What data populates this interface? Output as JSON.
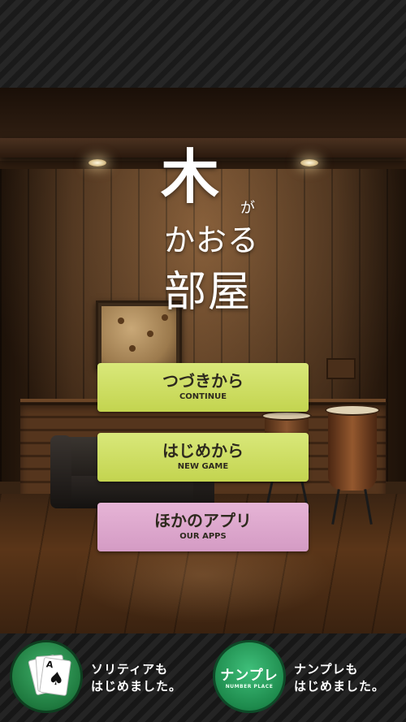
{
  "title": {
    "main": "木",
    "particle": "が",
    "line2": "かおる",
    "line3": "部屋"
  },
  "menu": [
    {
      "jp": "つづきから",
      "en": "CONTINUE",
      "color": "#cddd5f"
    },
    {
      "jp": "はじめから",
      "en": "NEW GAME",
      "color": "#cddd5f"
    },
    {
      "jp": "ほかのアプリ",
      "en": "OUR APPS",
      "color": "#dea8cd"
    }
  ],
  "promos": [
    {
      "icon": "solitaire-cards-icon",
      "text_line1": "ソリティアも",
      "text_line2": "はじめました。",
      "icon_card_rank": "A",
      "icon_card_suit": "♠",
      "icon_card_suit2": "♥"
    },
    {
      "icon": "number-place-icon",
      "icon_label": "ナンプレ",
      "icon_sublabel": "NUMBER PLACE",
      "text_line1": "ナンプレも",
      "text_line2": "はじめました。"
    }
  ]
}
